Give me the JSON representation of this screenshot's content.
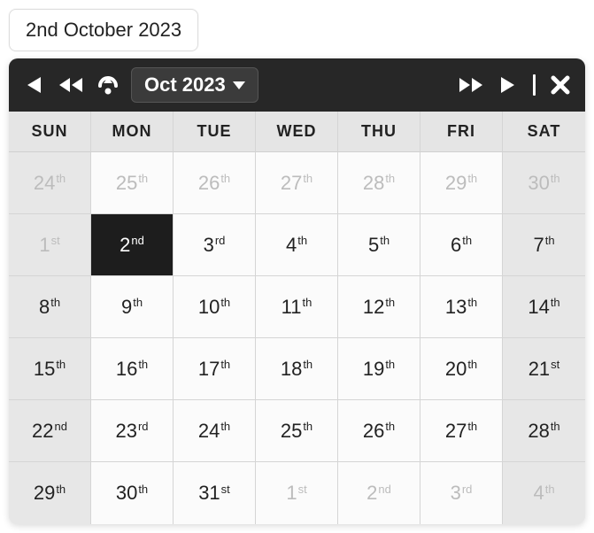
{
  "selected_label": "2nd October 2023",
  "toolbar": {
    "month_label": "Oct 2023"
  },
  "day_headers": [
    "SUN",
    "MON",
    "TUE",
    "WED",
    "THU",
    "FRI",
    "SAT"
  ],
  "weeks": [
    [
      {
        "day": "24",
        "ord": "th",
        "other": true,
        "weekend": true
      },
      {
        "day": "25",
        "ord": "th",
        "other": true
      },
      {
        "day": "26",
        "ord": "th",
        "other": true
      },
      {
        "day": "27",
        "ord": "th",
        "other": true
      },
      {
        "day": "28",
        "ord": "th",
        "other": true
      },
      {
        "day": "29",
        "ord": "th",
        "other": true
      },
      {
        "day": "30",
        "ord": "th",
        "other": true,
        "weekend": true
      }
    ],
    [
      {
        "day": "1",
        "ord": "st",
        "other": true,
        "weekend": true
      },
      {
        "day": "2",
        "ord": "nd",
        "selected": true
      },
      {
        "day": "3",
        "ord": "rd"
      },
      {
        "day": "4",
        "ord": "th"
      },
      {
        "day": "5",
        "ord": "th"
      },
      {
        "day": "6",
        "ord": "th"
      },
      {
        "day": "7",
        "ord": "th",
        "weekend": true
      }
    ],
    [
      {
        "day": "8",
        "ord": "th",
        "weekend": true
      },
      {
        "day": "9",
        "ord": "th"
      },
      {
        "day": "10",
        "ord": "th"
      },
      {
        "day": "11",
        "ord": "th"
      },
      {
        "day": "12",
        "ord": "th"
      },
      {
        "day": "13",
        "ord": "th"
      },
      {
        "day": "14",
        "ord": "th",
        "weekend": true
      }
    ],
    [
      {
        "day": "15",
        "ord": "th",
        "weekend": true
      },
      {
        "day": "16",
        "ord": "th"
      },
      {
        "day": "17",
        "ord": "th"
      },
      {
        "day": "18",
        "ord": "th"
      },
      {
        "day": "19",
        "ord": "th"
      },
      {
        "day": "20",
        "ord": "th"
      },
      {
        "day": "21",
        "ord": "st",
        "weekend": true
      }
    ],
    [
      {
        "day": "22",
        "ord": "nd",
        "weekend": true
      },
      {
        "day": "23",
        "ord": "rd"
      },
      {
        "day": "24",
        "ord": "th"
      },
      {
        "day": "25",
        "ord": "th"
      },
      {
        "day": "26",
        "ord": "th"
      },
      {
        "day": "27",
        "ord": "th"
      },
      {
        "day": "28",
        "ord": "th",
        "weekend": true
      }
    ],
    [
      {
        "day": "29",
        "ord": "th",
        "weekend": true
      },
      {
        "day": "30",
        "ord": "th"
      },
      {
        "day": "31",
        "ord": "st"
      },
      {
        "day": "1",
        "ord": "st",
        "other": true
      },
      {
        "day": "2",
        "ord": "nd",
        "other": true
      },
      {
        "day": "3",
        "ord": "rd",
        "other": true
      },
      {
        "day": "4",
        "ord": "th",
        "other": true,
        "weekend": true
      }
    ]
  ]
}
